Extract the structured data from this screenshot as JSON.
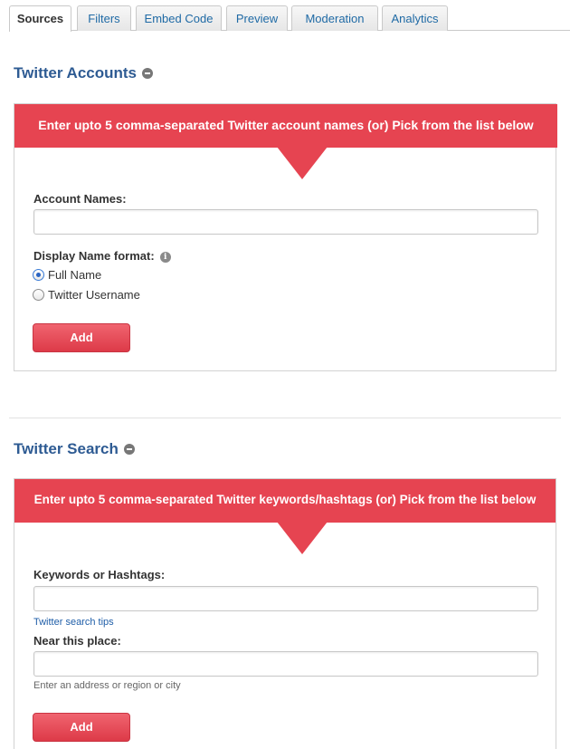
{
  "tabs": [
    {
      "label": "Sources",
      "active": true
    },
    {
      "label": "Filters"
    },
    {
      "label": "Embed Code"
    },
    {
      "label": "Preview"
    },
    {
      "label": "Moderation"
    },
    {
      "label": "Analytics"
    }
  ],
  "accounts": {
    "title": "Twitter Accounts",
    "banner": "Enter upto 5 comma-separated Twitter account names (or) Pick from the list below",
    "account_names_label": "Account Names:",
    "account_names_value": "",
    "display_format_label": "Display Name format:",
    "options": [
      {
        "label": "Full Name",
        "selected": true
      },
      {
        "label": "Twitter Username",
        "selected": false
      }
    ],
    "add_label": "Add"
  },
  "search": {
    "title": "Twitter Search",
    "banner": "Enter upto 5 comma-separated Twitter keywords/hashtags (or) Pick from the list below",
    "keywords_label": "Keywords or Hashtags:",
    "keywords_value": "",
    "tips_link": "Twitter search tips",
    "near_label": "Near this place:",
    "near_value": "",
    "near_hint": "Enter an address or region or city",
    "add_label": "Add"
  },
  "colors": {
    "banner": "#e64451",
    "heading": "#2e5b93",
    "link": "#1f6aa5"
  }
}
